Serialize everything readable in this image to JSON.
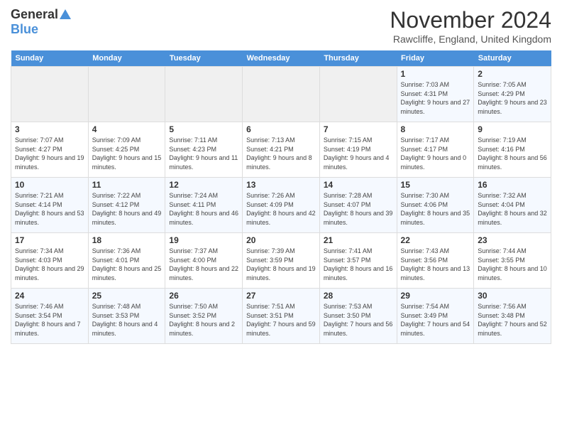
{
  "header": {
    "logo_general": "General",
    "logo_blue": "Blue",
    "month_title": "November 2024",
    "location": "Rawcliffe, England, United Kingdom"
  },
  "days_of_week": [
    "Sunday",
    "Monday",
    "Tuesday",
    "Wednesday",
    "Thursday",
    "Friday",
    "Saturday"
  ],
  "weeks": [
    [
      {
        "day": "",
        "info": ""
      },
      {
        "day": "",
        "info": ""
      },
      {
        "day": "",
        "info": ""
      },
      {
        "day": "",
        "info": ""
      },
      {
        "day": "",
        "info": ""
      },
      {
        "day": "1",
        "info": "Sunrise: 7:03 AM\nSunset: 4:31 PM\nDaylight: 9 hours and 27 minutes."
      },
      {
        "day": "2",
        "info": "Sunrise: 7:05 AM\nSunset: 4:29 PM\nDaylight: 9 hours and 23 minutes."
      }
    ],
    [
      {
        "day": "3",
        "info": "Sunrise: 7:07 AM\nSunset: 4:27 PM\nDaylight: 9 hours and 19 minutes."
      },
      {
        "day": "4",
        "info": "Sunrise: 7:09 AM\nSunset: 4:25 PM\nDaylight: 9 hours and 15 minutes."
      },
      {
        "day": "5",
        "info": "Sunrise: 7:11 AM\nSunset: 4:23 PM\nDaylight: 9 hours and 11 minutes."
      },
      {
        "day": "6",
        "info": "Sunrise: 7:13 AM\nSunset: 4:21 PM\nDaylight: 9 hours and 8 minutes."
      },
      {
        "day": "7",
        "info": "Sunrise: 7:15 AM\nSunset: 4:19 PM\nDaylight: 9 hours and 4 minutes."
      },
      {
        "day": "8",
        "info": "Sunrise: 7:17 AM\nSunset: 4:17 PM\nDaylight: 9 hours and 0 minutes."
      },
      {
        "day": "9",
        "info": "Sunrise: 7:19 AM\nSunset: 4:16 PM\nDaylight: 8 hours and 56 minutes."
      }
    ],
    [
      {
        "day": "10",
        "info": "Sunrise: 7:21 AM\nSunset: 4:14 PM\nDaylight: 8 hours and 53 minutes."
      },
      {
        "day": "11",
        "info": "Sunrise: 7:22 AM\nSunset: 4:12 PM\nDaylight: 8 hours and 49 minutes."
      },
      {
        "day": "12",
        "info": "Sunrise: 7:24 AM\nSunset: 4:11 PM\nDaylight: 8 hours and 46 minutes."
      },
      {
        "day": "13",
        "info": "Sunrise: 7:26 AM\nSunset: 4:09 PM\nDaylight: 8 hours and 42 minutes."
      },
      {
        "day": "14",
        "info": "Sunrise: 7:28 AM\nSunset: 4:07 PM\nDaylight: 8 hours and 39 minutes."
      },
      {
        "day": "15",
        "info": "Sunrise: 7:30 AM\nSunset: 4:06 PM\nDaylight: 8 hours and 35 minutes."
      },
      {
        "day": "16",
        "info": "Sunrise: 7:32 AM\nSunset: 4:04 PM\nDaylight: 8 hours and 32 minutes."
      }
    ],
    [
      {
        "day": "17",
        "info": "Sunrise: 7:34 AM\nSunset: 4:03 PM\nDaylight: 8 hours and 29 minutes."
      },
      {
        "day": "18",
        "info": "Sunrise: 7:36 AM\nSunset: 4:01 PM\nDaylight: 8 hours and 25 minutes."
      },
      {
        "day": "19",
        "info": "Sunrise: 7:37 AM\nSunset: 4:00 PM\nDaylight: 8 hours and 22 minutes."
      },
      {
        "day": "20",
        "info": "Sunrise: 7:39 AM\nSunset: 3:59 PM\nDaylight: 8 hours and 19 minutes."
      },
      {
        "day": "21",
        "info": "Sunrise: 7:41 AM\nSunset: 3:57 PM\nDaylight: 8 hours and 16 minutes."
      },
      {
        "day": "22",
        "info": "Sunrise: 7:43 AM\nSunset: 3:56 PM\nDaylight: 8 hours and 13 minutes."
      },
      {
        "day": "23",
        "info": "Sunrise: 7:44 AM\nSunset: 3:55 PM\nDaylight: 8 hours and 10 minutes."
      }
    ],
    [
      {
        "day": "24",
        "info": "Sunrise: 7:46 AM\nSunset: 3:54 PM\nDaylight: 8 hours and 7 minutes."
      },
      {
        "day": "25",
        "info": "Sunrise: 7:48 AM\nSunset: 3:53 PM\nDaylight: 8 hours and 4 minutes."
      },
      {
        "day": "26",
        "info": "Sunrise: 7:50 AM\nSunset: 3:52 PM\nDaylight: 8 hours and 2 minutes."
      },
      {
        "day": "27",
        "info": "Sunrise: 7:51 AM\nSunset: 3:51 PM\nDaylight: 7 hours and 59 minutes."
      },
      {
        "day": "28",
        "info": "Sunrise: 7:53 AM\nSunset: 3:50 PM\nDaylight: 7 hours and 56 minutes."
      },
      {
        "day": "29",
        "info": "Sunrise: 7:54 AM\nSunset: 3:49 PM\nDaylight: 7 hours and 54 minutes."
      },
      {
        "day": "30",
        "info": "Sunrise: 7:56 AM\nSunset: 3:48 PM\nDaylight: 7 hours and 52 minutes."
      }
    ]
  ]
}
